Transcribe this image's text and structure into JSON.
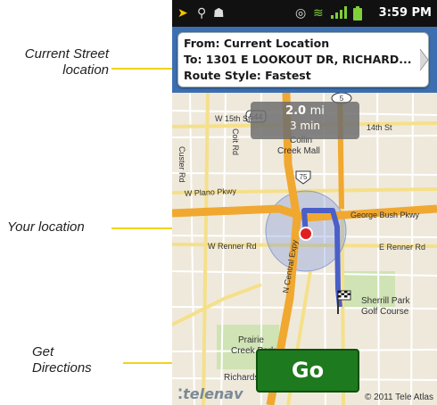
{
  "callouts": {
    "street": "Current Street\nlocation",
    "street_line1": "Current Street",
    "street_line2": "location",
    "your_location": "Your location",
    "get_line1": "Get",
    "get_line2": "Directions"
  },
  "status_bar": {
    "time": "3:59 PM"
  },
  "route": {
    "from": "From: Current Location",
    "to": "To: 1301 E LOOKOUT DR, RICHARD...",
    "style": "Route Style: Fastest"
  },
  "trip": {
    "distance": "2.0",
    "distance_unit": "mi",
    "duration": "3 min"
  },
  "map_labels": {
    "w15th": "W 15th St",
    "e14th": "14th St",
    "collin": "Collin",
    "creek_mall": "Creek Mall",
    "w_plano": "W Plano Pkwy",
    "bush": "George Bush Pkwy",
    "w_renner": "W Renner Rd",
    "e_renner": "E Renner Rd",
    "n_central": "N Central Expy",
    "custer": "Custer Rd",
    "coit": "Coit Rd",
    "sherrill1": "Sherrill Park",
    "sherrill2": "Golf Course",
    "prairie1": "Prairie",
    "prairie2": "Creek Park",
    "richardson": "Richardson",
    "shield_544": "544",
    "shield_75": "75",
    "shield_5": "5"
  },
  "actions": {
    "go": "Go"
  },
  "branding": {
    "telenav": "telenav",
    "copyright": "© 2011 Tele Atlas"
  },
  "colors": {
    "route_line": "#4a5fc8",
    "highway": "#f0a830",
    "go_button": "#1e7a1e",
    "callout_line": "#f2d21b"
  }
}
